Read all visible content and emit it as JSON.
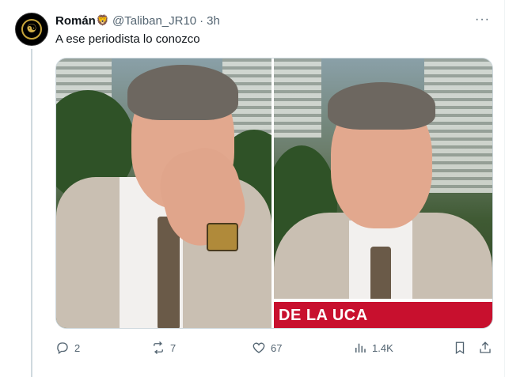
{
  "tweet": {
    "author_name": "Román",
    "author_emoji": "🦁",
    "handle": "@Taliban_JR10",
    "separator": "·",
    "time": "3h",
    "more_label": "···",
    "text": "A ese periodista lo conozco"
  },
  "media": {
    "ticker_text": "DE LA UCA"
  },
  "actions": {
    "replies": "2",
    "reposts": "7",
    "likes": "67",
    "views": "1.4K"
  },
  "icons": {
    "reply": "reply-icon",
    "repost": "repost-icon",
    "like": "heart-icon",
    "views": "views-chart-icon",
    "bookmark": "bookmark-icon",
    "share": "share-icon"
  },
  "colors": {
    "text": "#0f1419",
    "secondary": "#536471",
    "ticker": "#c8102e",
    "border": "#cfd9de"
  }
}
